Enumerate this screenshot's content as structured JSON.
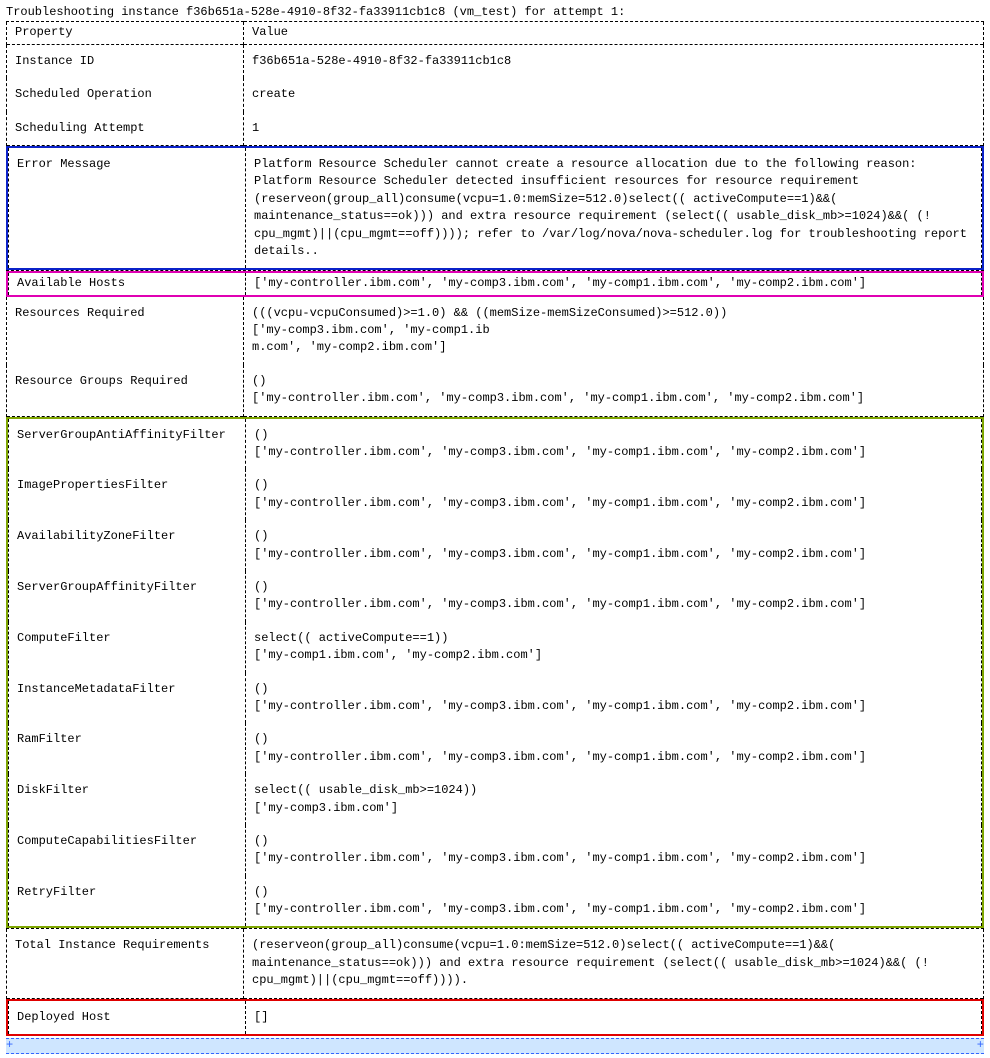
{
  "title": "Troubleshooting instance f36b651a-528e-4910-8f32-fa33911cb1c8 (vm_test) for attempt 1:",
  "headers": {
    "property": "Property",
    "value": "Value"
  },
  "rows": {
    "instance_id": {
      "prop": "Instance ID",
      "val": "f36b651a-528e-4910-8f32-fa33911cb1c8"
    },
    "scheduled_op": {
      "prop": "Scheduled Operation",
      "val": "create"
    },
    "scheduling_attempt": {
      "prop": "Scheduling Attempt",
      "val": "1"
    },
    "error_message": {
      "prop": "Error Message",
      "val": "Platform Resource Scheduler cannot create a resource allocation due to the following reason: Platform Resource Scheduler detected insufficient resources for resource requirement (reserveon(group_all)consume(vcpu=1.0:memSize=512.0)select(( activeCompute==1)&&( maintenance_status==ok))) and extra resource requirement (select(( usable_disk_mb>=1024)&&( (! cpu_mgmt)||(cpu_mgmt==off)))); refer to /var/log/nova/nova-scheduler.log for troubleshooting report details.."
    },
    "available_hosts": {
      "prop": "Available Hosts",
      "val": "['my-controller.ibm.com', 'my-comp3.ibm.com', 'my-comp1.ibm.com', 'my-comp2.ibm.com']"
    },
    "resources_required": {
      "prop": "Resources Required",
      "val": "(((vcpu-vcpuConsumed)>=1.0) && ((memSize-memSizeConsumed)>=512.0))\n['my-comp3.ibm.com', 'my-comp1.ib\nm.com', 'my-comp2.ibm.com']"
    },
    "resource_groups_required": {
      "prop": "Resource Groups Required",
      "val": "()\n['my-controller.ibm.com', 'my-comp3.ibm.com', 'my-comp1.ibm.com', 'my-comp2.ibm.com']"
    },
    "filter_sgantiaff": {
      "prop": "ServerGroupAntiAffinityFilter",
      "val": "()\n['my-controller.ibm.com', 'my-comp3.ibm.com', 'my-comp1.ibm.com', 'my-comp2.ibm.com']"
    },
    "filter_imageprops": {
      "prop": "ImagePropertiesFilter",
      "val": "()\n['my-controller.ibm.com', 'my-comp3.ibm.com', 'my-comp1.ibm.com', 'my-comp2.ibm.com']"
    },
    "filter_az": {
      "prop": "AvailabilityZoneFilter",
      "val": "()\n['my-controller.ibm.com', 'my-comp3.ibm.com', 'my-comp1.ibm.com', 'my-comp2.ibm.com']"
    },
    "filter_sgaff": {
      "prop": "ServerGroupAffinityFilter",
      "val": "()\n['my-controller.ibm.com', 'my-comp3.ibm.com', 'my-comp1.ibm.com', 'my-comp2.ibm.com']"
    },
    "filter_compute": {
      "prop": "ComputeFilter",
      "val": "select(( activeCompute==1))\n['my-comp1.ibm.com', 'my-comp2.ibm.com']"
    },
    "filter_instance_meta": {
      "prop": "InstanceMetadataFilter",
      "val": "()\n['my-controller.ibm.com', 'my-comp3.ibm.com', 'my-comp1.ibm.com', 'my-comp2.ibm.com']"
    },
    "filter_ram": {
      "prop": "RamFilter",
      "val": "()\n['my-controller.ibm.com', 'my-comp3.ibm.com', 'my-comp1.ibm.com', 'my-comp2.ibm.com']"
    },
    "filter_disk": {
      "prop": "DiskFilter",
      "val": "select(( usable_disk_mb>=1024))\n['my-comp3.ibm.com']"
    },
    "filter_compute_caps": {
      "prop": "ComputeCapabilitiesFilter",
      "val": "()\n['my-controller.ibm.com', 'my-comp3.ibm.com', 'my-comp1.ibm.com', 'my-comp2.ibm.com']"
    },
    "filter_retry": {
      "prop": "RetryFilter",
      "val": "()\n['my-controller.ibm.com', 'my-comp3.ibm.com', 'my-comp1.ibm.com', 'my-comp2.ibm.com']"
    },
    "total_instance_reqs": {
      "prop": "Total Instance Requirements",
      "val": "(reserveon(group_all)consume(vcpu=1.0:memSize=512.0)select(( activeCompute==1)&&( maintenance_status==ok))) and extra resource requirement (select(( usable_disk_mb>=1024)&&( (! cpu_mgmt)||(cpu_mgmt==off))))."
    },
    "deployed_host": {
      "prop": "Deployed Host",
      "val": "[]"
    }
  },
  "highlight_colors": {
    "error_message": "#0b22c9",
    "available_hosts": "#e000b3",
    "filters_block": "#7ea500",
    "deployed_host": "#e00000",
    "selection_bg": "#cfe6ff"
  }
}
